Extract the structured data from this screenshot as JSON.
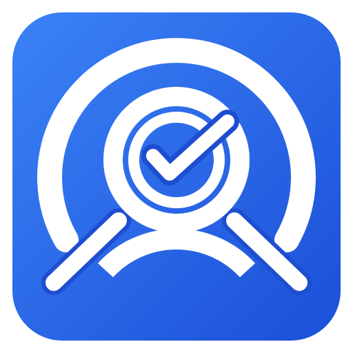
{
  "icon": {
    "name": "search-verify-app-icon",
    "glyph": "magnifier-with-checkmark-icon",
    "colors": {
      "background_light": "#3B82F6",
      "background_dark": "#1B4FD8",
      "foreground": "#FFFFFF",
      "outline": "#1E4ED0"
    }
  }
}
